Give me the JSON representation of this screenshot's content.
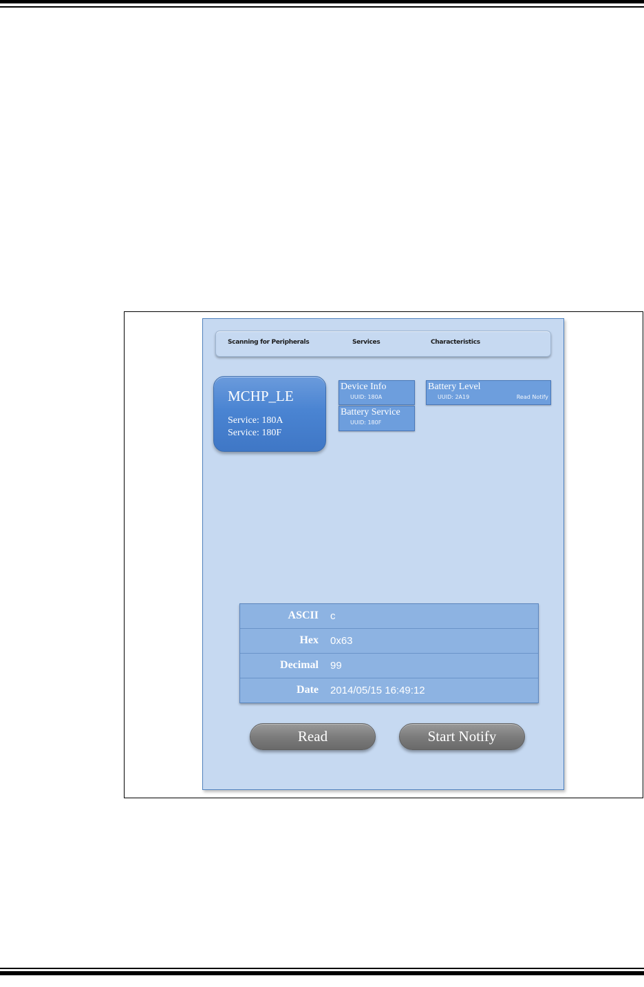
{
  "nav": {
    "scanning": "Scanning for Peripherals",
    "services": "Services",
    "characteristics": "Characteristics"
  },
  "device": {
    "name": "MCHP_LE",
    "services": [
      "Service: 180A",
      "Service: 180F"
    ]
  },
  "services": [
    {
      "title": "Device Info",
      "uuid": "UUID: 180A"
    },
    {
      "title": "Battery Service",
      "uuid": "UUID: 180F"
    }
  ],
  "characteristic": {
    "title": "Battery Level",
    "uuid": "UUID: 2A19",
    "properties": "Read Notify"
  },
  "values": [
    {
      "label": "ASCII",
      "value": "c"
    },
    {
      "label": "Hex",
      "value": "0x63"
    },
    {
      "label": "Decimal",
      "value": "99"
    },
    {
      "label": "Date",
      "value": "2014/05/15 16:49:12"
    }
  ],
  "buttons": {
    "read": "Read",
    "start_notify": "Start Notify"
  },
  "colors": {
    "window_bg": "#c6d9f1",
    "device_card": "#4a84d2",
    "service_box": "#6d9edd",
    "table_bg": "#8db3e2",
    "button_gray": "#7c7c7c"
  }
}
